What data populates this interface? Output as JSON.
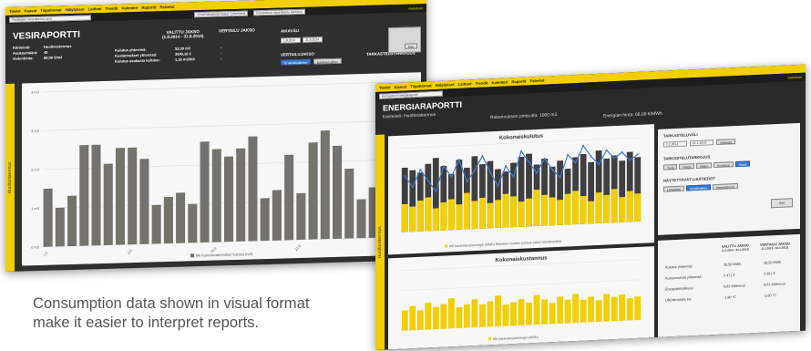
{
  "menu": [
    "Tiedot",
    "Kaavat",
    "Tiigaltiomat",
    "Hälytykset",
    "Laitteet",
    "Trendit",
    "Kalenteri",
    "Raportit",
    "Palvelut"
  ],
  "water": {
    "selector_value": "Pentbaiser Vesirakentuu.an.s",
    "tab1": "Omat hälytyksiä Rasiat Työtehtäviä",
    "tab2": "Poistotietoa raporttitaulu (tiedetty)",
    "user": "Asetukset",
    "title": "VESIRAPORTTI",
    "period_header": "VALITTU JAKSO",
    "period_range": "(1.8.2014 - 31.8.2014)",
    "compare_header": "VERTAILU JAKSO",
    "info": {
      "kiinteisto_label": "Kiinteistö:",
      "kiinteisto": "Huoltorakennus",
      "asukas_label": "Asukasmäärä:",
      "asukas": "45",
      "hinta_label": "Vedenhinta:",
      "hinta": "68,08 €/m3"
    },
    "stats": [
      {
        "label": "Kulutus yhteensä:",
        "val": "52,00 m3",
        "cmp": "-"
      },
      {
        "label": "Kustannukset yhteensä:",
        "val": "3540,16 €",
        "cmp": "-"
      },
      {
        "label": "Kulutus asukasta kohden:",
        "val": "1,16 m3/hlö",
        "cmp": "-"
      }
    ],
    "aikavali": "AIKAVÄLI",
    "date_from": "1.8.2014",
    "date_to": "31.8.2014",
    "vertailu": "VERTAILUJAKSO",
    "btn1": "Ei vertailujaksoa",
    "btn2": "Edellinen jakso",
    "tarkastelu": "TARKASTELUTARKKUUS",
    "hae": "Hae",
    "side": "Huoltorakennus",
    "legend": "Mit Kylmävedenmittari kulutus (m3)",
    "yticks": [
      "4 m3",
      "3 m3",
      "2 m3",
      "1 m3",
      "0 m3"
    ],
    "xticks": [
      "1.8",
      "8.8",
      "15.8",
      "22.8"
    ]
  },
  "energy": {
    "selector_value": "Kriimpelteli Energiaraportti",
    "title": "ENERGIARAPORTTI",
    "kiinteisto": "Kiinteistö: Huoltorakennus",
    "pinta": "Rakennuksen pinta-ala: 1000 m3",
    "hinta": "Energian hinta: 68,08 €/MWh",
    "user": "Asetukset",
    "chart1_title": "Kokonaiskulutus",
    "chart2_title": "Kokonaiskustannus",
    "legend1": "M6 Kaukolämpöenergia (MWh)   Edellisen vuoden kulutus (ulos)   Ulkolämpötila",
    "legend2": "M6 Kaukolämpöenergia (MWh)",
    "side": "Huoltorakennus",
    "aikavali": "TARKASTELUVÄLI",
    "date_from": "1.1.2014",
    "date_to": "31.1.2014",
    "btn_ok": "Vahvista",
    "tarkkuus": "TARKASTELUTARKKUUS",
    "tark_buttons": [
      "Tunti",
      "Päivä",
      "Viikko",
      "Kuukausi",
      "Vuosi"
    ],
    "lisatiedot": "NÄYTETTÄVÄT LISÄTIEDOT",
    "lis_buttons": [
      "Lämpötila",
      "Vertailujakso",
      "Normalisointi"
    ],
    "hae": "Hae",
    "stats_head1": "VALITTU JAKSO",
    "stats_head1b": "(1.1.2014 - 31.1.2014)",
    "stats_head2": "VERTAILU JAKSO",
    "stats_head2b": "(1.1.2013 - 31.1.2013)",
    "stats": [
      {
        "label": "Kulutus yhteensä:",
        "v1": "36,50 MWh",
        "v2": "36,50 MWh"
      },
      {
        "label": "Kustannukset yhteensä:",
        "v1": "2 471 €",
        "v2": "2 381 €"
      },
      {
        "label": "Energiatehokkuus:",
        "v1": "0,03 MWh/m3",
        "v2": "0,03 MWh/m3"
      },
      {
        "label": "Ulkolämpötila ka:",
        "v1": "-1,90 °C",
        "v2": "-1,60 °C"
      }
    ]
  },
  "caption": "Consumption data shown in visual format make it easier to interpret reports.",
  "chart_data": [
    {
      "type": "bar",
      "title": "",
      "ylabel": "",
      "ylim": [
        0,
        4
      ],
      "categories": [
        "1.8",
        "2.8",
        "3.8",
        "4.8",
        "5.8",
        "6.8",
        "7.8",
        "8.8",
        "9.8",
        "10.8",
        "11.8",
        "12.8",
        "13.8",
        "14.8",
        "15.8",
        "16.8",
        "17.8",
        "18.8",
        "19.8",
        "20.8",
        "21.8",
        "22.8",
        "23.8",
        "24.8",
        "25.8",
        "26.8",
        "27.8",
        "28.8",
        "29.8",
        "30.8",
        "31.8"
      ],
      "series": [
        {
          "name": "Mit Kylmävedenmittari kulutus (m3)",
          "values": [
            1.5,
            1.0,
            1.3,
            2.6,
            2.6,
            2.1,
            2.5,
            2.5,
            2.2,
            1.0,
            1.2,
            1.3,
            1.0,
            2.6,
            2.4,
            2.2,
            2.4,
            2.7,
            1.1,
            1.3,
            2.2,
            1.2,
            2.5,
            2.8,
            2.4,
            1.8,
            1.0,
            1.3,
            1.3,
            1.1,
            2.7
          ]
        }
      ]
    },
    {
      "type": "bar",
      "title": "Kokonaiskulutus",
      "ylim": [
        0,
        3
      ],
      "series": [
        {
          "name": "Edellisen vuoden kulutus",
          "values": [
            2.3,
            2.2,
            2.1,
            2.4,
            2.6,
            2.3,
            2.0,
            2.5,
            2.2,
            2.6,
            2.3,
            2.4,
            2.1,
            2.0,
            2.3,
            2.5,
            2.6,
            2.2,
            2.4,
            2.1,
            2.3,
            2.0,
            2.4,
            2.5,
            2.2,
            2.6,
            2.3,
            2.4,
            2.2,
            2.5,
            2.3
          ]
        },
        {
          "name": "M6 Kaukolämpöenergia (MWh)",
          "values": [
            1.0,
            0.9,
            1.1,
            1.2,
            0.8,
            1.0,
            1.1,
            0.9,
            1.3,
            1.0,
            1.1,
            0.9,
            1.0,
            1.2,
            1.1,
            0.9,
            1.0,
            1.3,
            1.1,
            1.0,
            0.9,
            1.1,
            1.2,
            1.0,
            0.8,
            1.1,
            1.0,
            1.2,
            0.9,
            1.1,
            1.0
          ]
        },
        {
          "name": "Ulkolämpötila",
          "values": [
            2.0,
            1.6,
            2.2,
            1.8,
            1.4,
            2.3,
            1.9,
            2.5,
            1.7,
            2.1,
            2.6,
            2.0,
            1.5,
            2.2,
            1.8,
            2.7,
            2.3,
            1.9,
            2.4,
            2.0,
            1.7,
            2.5,
            2.2,
            2.8,
            2.4,
            2.1,
            2.6,
            2.3,
            2.5,
            2.2,
            2.4
          ]
        }
      ]
    },
    {
      "type": "bar",
      "title": "Kokonaiskustannus",
      "ylim": [
        0,
        180
      ],
      "series": [
        {
          "name": "M6 Kaukolämpöenergia (MWh)",
          "values": [
            60,
            72,
            58,
            80,
            66,
            74,
            90,
            62,
            70,
            84,
            68,
            76,
            92,
            64,
            70,
            78,
            66,
            88,
            74,
            62,
            80,
            70,
            86,
            68,
            76,
            64,
            82,
            72,
            78,
            66,
            70
          ]
        }
      ]
    }
  ]
}
